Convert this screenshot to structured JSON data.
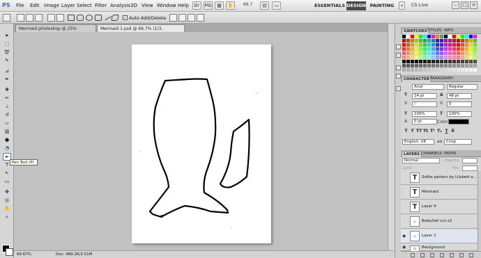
{
  "app": {
    "logo": "PS"
  },
  "menu": [
    "File",
    "Edit",
    "Image",
    "Layer",
    "Select",
    "Filter",
    "Analysis",
    "3D",
    "View",
    "Window",
    "Help"
  ],
  "toolbar": {
    "zoom": "66.7"
  },
  "workspaces": {
    "essentials": "ESSENTIALS",
    "design": "DESIGN",
    "painting": "PAINTING",
    "cs_live": "CS Live"
  },
  "options_bar": {
    "auto_add_delete": "Auto Add/Delete",
    "auto_add_checked": true
  },
  "doc_tabs": [
    {
      "label": "Mermaid photoshop @ 25% (Gray/8)"
    },
    {
      "label": "Mermaid 1.psd @ 66.7% (1/3, Gray/8)"
    }
  ],
  "tools": {
    "tooltip": "Pen Tool (P)"
  },
  "status": {
    "zoom": "66.67%",
    "doc": "Doc: 489.2K/3.51M"
  },
  "swatches": {
    "tabs": [
      "SWATCHES",
      "STYLES",
      "INFO"
    ],
    "colors": [
      "#000000",
      "#ffffff",
      "#ff0000",
      "#ffff00",
      "#00ff00",
      "#00ffff",
      "#0000ff",
      "#ff00ff",
      "#ff8000",
      "#808080"
    ]
  },
  "character": {
    "tabs": [
      "CHARACTER",
      "PARAGRAPH"
    ],
    "font_family": "Arial",
    "font_style": "Regular",
    "font_size": "14 pt",
    "leading": "48 pt",
    "kerning": "0",
    "tracking": "0",
    "vertical_scale": "100%",
    "horizontal_scale": "100%",
    "baseline_shift": "0 pt",
    "color_label": "Color:",
    "language": "English: UK",
    "antialias": "Crisp"
  },
  "layers": {
    "tabs": [
      "LAYERS",
      "CHANNELS",
      "PATHS"
    ],
    "blend_mode": "Normal",
    "opacity_label": "Opacity:",
    "lock_label": "Lock:",
    "fill_label": "Fill:",
    "items": [
      {
        "name": "Softie pattern by Lilybett a...",
        "type": "text",
        "visible": false
      },
      {
        "name": "Mermaid",
        "type": "text",
        "visible": false
      },
      {
        "name": "Layer 4",
        "type": "text",
        "visible": false
      },
      {
        "name": "Body/tail cut x2",
        "type": "image",
        "visible": false
      },
      {
        "name": "Layer 1",
        "type": "image",
        "visible": true
      },
      {
        "name": "Background",
        "type": "image",
        "visible": true
      }
    ]
  }
}
